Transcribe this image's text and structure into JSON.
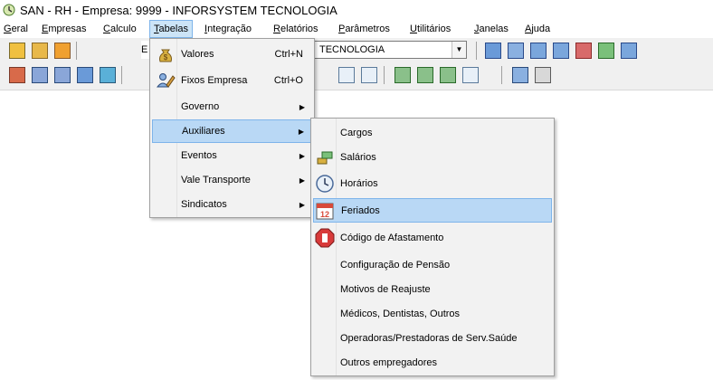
{
  "window": {
    "title": "SAN - RH - Empresa: 9999 - INFORSYSTEM TECNOLOGIA"
  },
  "menubar": {
    "items": [
      "Geral",
      "Empresas",
      "Calculo",
      "Tabelas",
      "Integração",
      "Relatórios",
      "Parâmetros",
      "Utilitários",
      "Janelas",
      "Ajuda"
    ]
  },
  "toolbar": {
    "company_combo_prefix": "E",
    "company_combo_value": "TECNOLOGIA"
  },
  "tabelas_menu": {
    "items": [
      {
        "label": "Valores",
        "shortcut": "Ctrl+N",
        "icon": "money-bag-icon"
      },
      {
        "label": "Fixos Empresa",
        "shortcut": "Ctrl+O",
        "icon": "people-edit-icon"
      },
      {
        "label": "Governo",
        "submenu": true
      },
      {
        "label": "Auxiliares",
        "submenu": true
      },
      {
        "label": "Eventos",
        "submenu": true
      },
      {
        "label": "Vale Transporte",
        "submenu": true
      },
      {
        "label": "Sindicatos",
        "submenu": true
      }
    ]
  },
  "auxiliares_menu": {
    "items": [
      {
        "label": "Cargos"
      },
      {
        "label": "Salários",
        "icon": "salary-icon"
      },
      {
        "label": "Horários",
        "icon": "clock-icon"
      },
      {
        "label": "Feriados",
        "icon": "calendar-icon"
      },
      {
        "label": "Código de Afastamento",
        "icon": "stop-sign-icon"
      },
      {
        "label": "Configuração de Pensão"
      },
      {
        "label": "Motivos de Reajuste"
      },
      {
        "label": "Médicos, Dentistas, Outros"
      },
      {
        "label": "Operadoras/Prestadoras de Serv.Saúde"
      },
      {
        "label": "Outros empregadores"
      }
    ]
  },
  "colors": {
    "highlight": "#b9d8f5",
    "highlight_border": "#7eb4ea",
    "menu_bg": "#f2f2f2"
  }
}
